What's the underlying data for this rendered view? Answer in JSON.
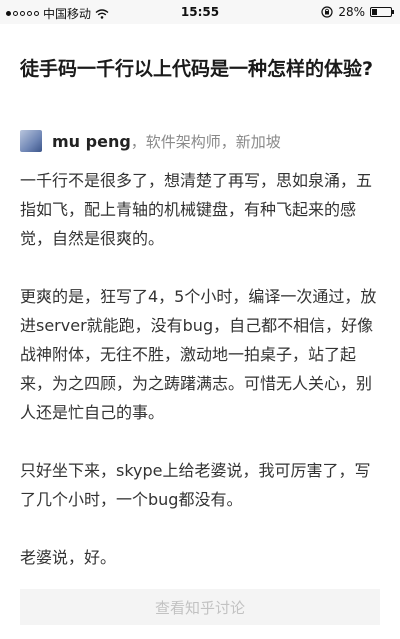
{
  "status_bar": {
    "carrier": "中国移动",
    "time": "15:55",
    "battery": "28%",
    "battery_level": 0.28,
    "signal_bars": 1,
    "icons": [
      "signal-icon",
      "wifi-icon",
      "lock-rotation-icon",
      "battery-icon"
    ]
  },
  "question": {
    "title": "徒手码一千行以上代码是一种怎样的体验?"
  },
  "author": {
    "name": "mu peng",
    "title": "，软件架构师，新加坡"
  },
  "answer": {
    "paragraphs": [
      "一千行不是很多了，想清楚了再写，思如泉涌，五指如飞，配上青轴的机械键盘，有种飞起来的感觉，自然是很爽的。",
      "更爽的是，狂写了4，5个小时，编译一次通过，放进server就能跑，没有bug，自己都不相信，好像战神附体，无往不胜，激动地一拍桌子，站了起来，为之四顾，为之踌躇满志。可惜无人关心，别人还是忙自己的事。",
      "只好坐下来，skype上给老婆说，我可厉害了，写了几个小时，一个bug都没有。",
      "老婆说，好。"
    ]
  },
  "footer": {
    "button_label": "查看知乎讨论"
  }
}
